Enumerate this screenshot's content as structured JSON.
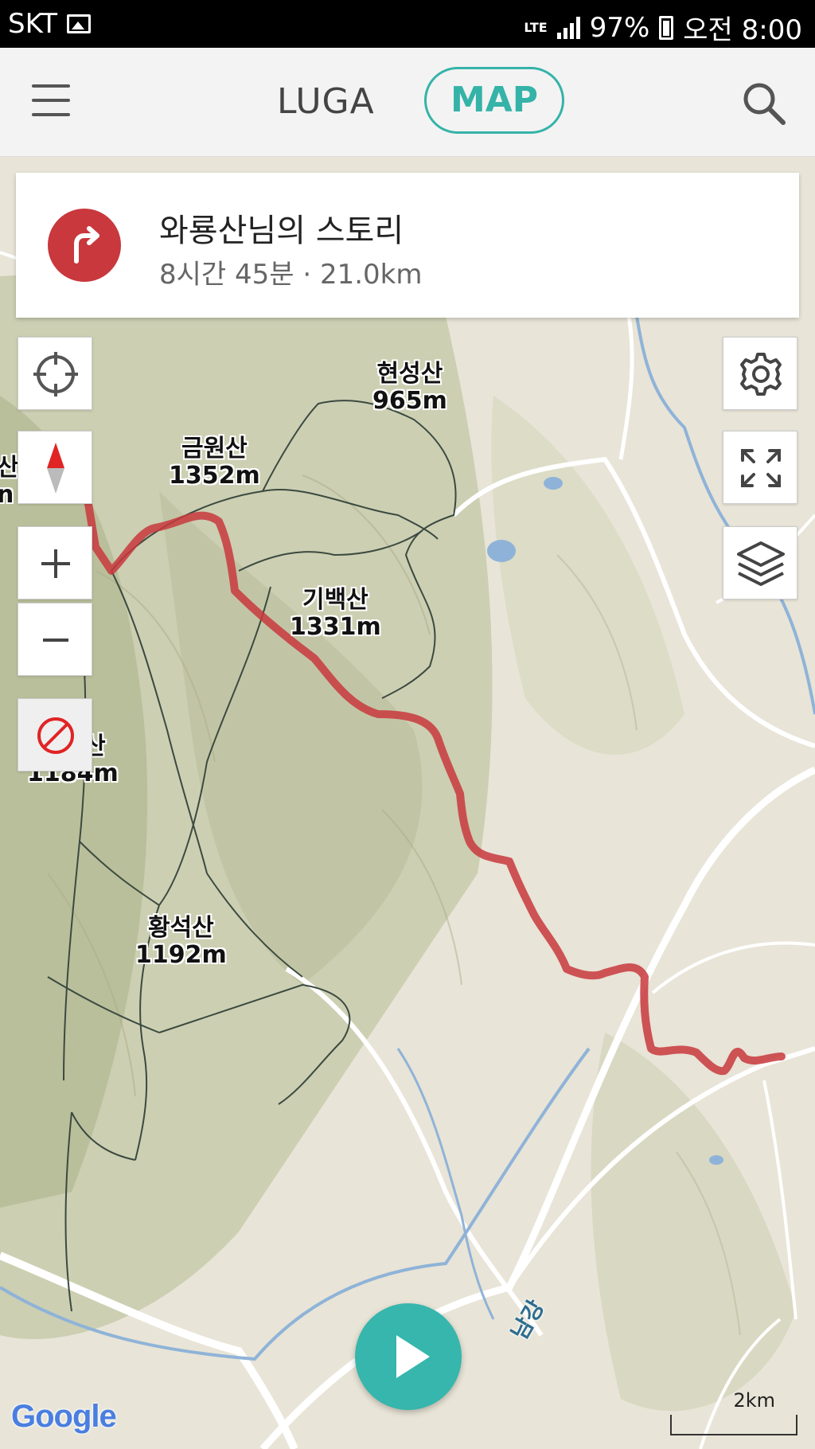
{
  "status_bar": {
    "carrier": "SKT",
    "network": "LTE",
    "battery": "97%",
    "time": "오전 8:00",
    "icons": [
      "image-notification-icon",
      "signal-icon",
      "battery-icon"
    ]
  },
  "app_bar": {
    "menu_icon": "hamburger-icon",
    "tab_luga": "LUGA",
    "tab_map": "MAP",
    "search_icon": "search-icon",
    "accent_color": "#35b3a8"
  },
  "story": {
    "title": "와룡산님의 스토리",
    "subtitle": "8시간 45분 · 21.0km",
    "icon": "turn-right-icon",
    "icon_color": "#c8383d"
  },
  "map": {
    "left_controls": [
      "my-location-icon",
      "compass-icon",
      "zoom-in-icon",
      "zoom-out-icon",
      "no-entry-icon"
    ],
    "right_controls": [
      "gear-icon",
      "fullscreen-icon",
      "layers-icon"
    ],
    "peaks": [
      {
        "name": "현성산",
        "elevation": "965m"
      },
      {
        "name": "금원산",
        "elevation": "1352m"
      },
      {
        "name": "기백산",
        "elevation": "1331m"
      },
      {
        "name": "거망산",
        "elevation": "1184m"
      },
      {
        "name": "황석산",
        "elevation": "1192m"
      }
    ],
    "edge_label_top": "산",
    "edge_label_bottom": "n",
    "river": "남강",
    "route_color": "#c8383d",
    "scale": "2km",
    "attribution": "Google"
  },
  "play_icon": "play-icon"
}
